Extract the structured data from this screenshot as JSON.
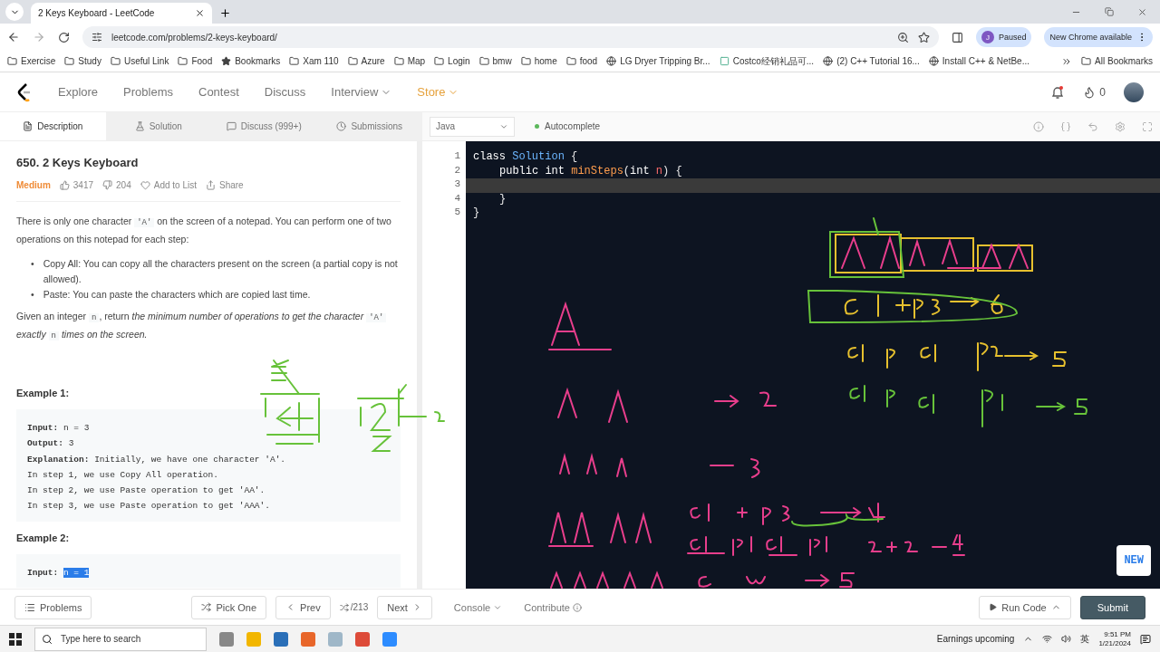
{
  "browser": {
    "tab_title": "2 Keys Keyboard - LeetCode",
    "url": "leetcode.com/problems/2-keys-keyboard/",
    "profile_initial": "J",
    "profile_status": "Paused",
    "update": "New Chrome available",
    "bookmarks": [
      {
        "label": "Exercise",
        "kind": "folder"
      },
      {
        "label": "Study",
        "kind": "folder"
      },
      {
        "label": "Useful Link",
        "kind": "folder"
      },
      {
        "label": "Food",
        "kind": "folder"
      },
      {
        "label": "Bookmarks",
        "kind": "star"
      },
      {
        "label": "Xam 110",
        "kind": "folder"
      },
      {
        "label": "Azure",
        "kind": "folder"
      },
      {
        "label": "Map",
        "kind": "folder"
      },
      {
        "label": "Login",
        "kind": "folder"
      },
      {
        "label": "bmw",
        "kind": "folder"
      },
      {
        "label": "home",
        "kind": "folder"
      },
      {
        "label": "food",
        "kind": "folder"
      },
      {
        "label": "LG Dryer Tripping Br...",
        "kind": "globe"
      },
      {
        "label": "Costco经销礼品可...",
        "kind": "site"
      },
      {
        "label": "(2) C++ Tutorial 16...",
        "kind": "globe"
      },
      {
        "label": "Install C++ & NetBe...",
        "kind": "globe"
      }
    ],
    "all_bookmarks": "All Bookmarks"
  },
  "nav": {
    "items": [
      {
        "label": "Explore",
        "dropdown": false,
        "highlighted": false
      },
      {
        "label": "Problems",
        "dropdown": false,
        "highlighted": false
      },
      {
        "label": "Contest",
        "dropdown": false,
        "highlighted": false
      },
      {
        "label": "Discuss",
        "dropdown": false,
        "highlighted": false
      },
      {
        "label": "Interview",
        "dropdown": true,
        "highlighted": false
      },
      {
        "label": "Store",
        "dropdown": true,
        "highlighted": true
      }
    ],
    "streak": "0"
  },
  "tabs": [
    {
      "label": "Description",
      "kind": "description",
      "selected": true
    },
    {
      "label": "Solution",
      "kind": "solution",
      "selected": false
    },
    {
      "label": "Discuss (999+)",
      "kind": "discuss",
      "selected": false
    },
    {
      "label": "Submissions",
      "kind": "submissions",
      "selected": false
    }
  ],
  "editor_bar": {
    "language": "Java",
    "autocomplete": "Autocomplete"
  },
  "problem": {
    "title": "650. 2 Keys Keyboard",
    "difficulty": "Medium",
    "likes": "3417",
    "dislikes": "204",
    "add_to_list": "Add to List",
    "share": "Share",
    "intro": [
      {
        "kind": "plain",
        "text": "There is only one character "
      },
      {
        "kind": "code",
        "text": "'A'"
      },
      {
        "kind": "plain",
        "text": " on the screen of a notepad. You can perform one of two operations on this notepad for each step:"
      }
    ],
    "bullets": [
      {
        "marker": "•",
        "term": "Copy All",
        "text": ": You can copy all the characters present on the screen (a partial copy is not allowed)."
      },
      {
        "marker": "•",
        "term": "Paste",
        "text": ": You can paste the characters which are copied last time."
      }
    ],
    "task": [
      {
        "kind": "plain",
        "text": "Given an integer "
      },
      {
        "kind": "code",
        "text": "n"
      },
      {
        "kind": "plain",
        "text": ", return "
      },
      {
        "kind": "italic",
        "text": "the minimum number of operations to get the character "
      },
      {
        "kind": "code",
        "text": "'A'"
      },
      {
        "kind": "italic",
        "text": " exactly "
      },
      {
        "kind": "code",
        "text": "n"
      },
      {
        "kind": "italic",
        "text": " times on the screen."
      }
    ],
    "examples": [
      {
        "title": "Example 1:",
        "lines": [
          {
            "label": "Input:",
            "text": "n = 3",
            "selected": false
          },
          {
            "label": "Output:",
            "text": "3",
            "selected": false
          },
          {
            "label": "Explanation:",
            "text": "Initially, we have one character 'A'.",
            "selected": false
          },
          {
            "text": "In step 1, we use Copy All operation.",
            "selected": false
          },
          {
            "text": "In step 2, we use Paste operation to get 'AA'.",
            "selected": false
          },
          {
            "text": "In step 3, we use Paste operation to get 'AAA'.",
            "selected": false
          }
        ]
      },
      {
        "title": "Example 2:",
        "lines": [
          {
            "label": "Input:",
            "text": "n = 1",
            "selected": true
          }
        ]
      }
    ]
  },
  "code": [
    {
      "number": "1",
      "current": false,
      "tokens": [
        {
          "kind": "keyword",
          "text": "class"
        },
        {
          "kind": "type",
          "text": " Solution"
        },
        {
          "kind": "plain",
          "text": " {"
        }
      ]
    },
    {
      "number": "2",
      "current": false,
      "indented": true,
      "tokens": [
        {
          "kind": "keyword",
          "text": "public int"
        },
        {
          "kind": "func",
          "text": " minSteps"
        },
        {
          "kind": "plain",
          "text": "("
        },
        {
          "kind": "keyword",
          "text": "int"
        },
        {
          "kind": "param",
          "text": " n"
        },
        {
          "kind": "plain",
          "text": ") {"
        }
      ]
    },
    {
      "number": "3",
      "current": true
    },
    {
      "number": "4",
      "current": false,
      "indented": true,
      "tokens": [
        {
          "kind": "plain",
          "text": "}"
        }
      ]
    },
    {
      "number": "5",
      "current": false,
      "tokens": [
        {
          "kind": "plain",
          "text": "}"
        }
      ]
    }
  ],
  "new_badge": "NEW",
  "footer": {
    "problems": "Problems",
    "pick_one": "Pick One",
    "prev": "Prev",
    "counter": "/213",
    "next": "Next",
    "console": "Console",
    "contribute": "Contribute",
    "run_code": "Run Code",
    "submit": "Submit"
  },
  "taskbar": {
    "search_placeholder": "Type here to search",
    "news": "Earnings upcoming",
    "ime": "英",
    "time": "9:51 PM",
    "date": "1/21/2024"
  }
}
